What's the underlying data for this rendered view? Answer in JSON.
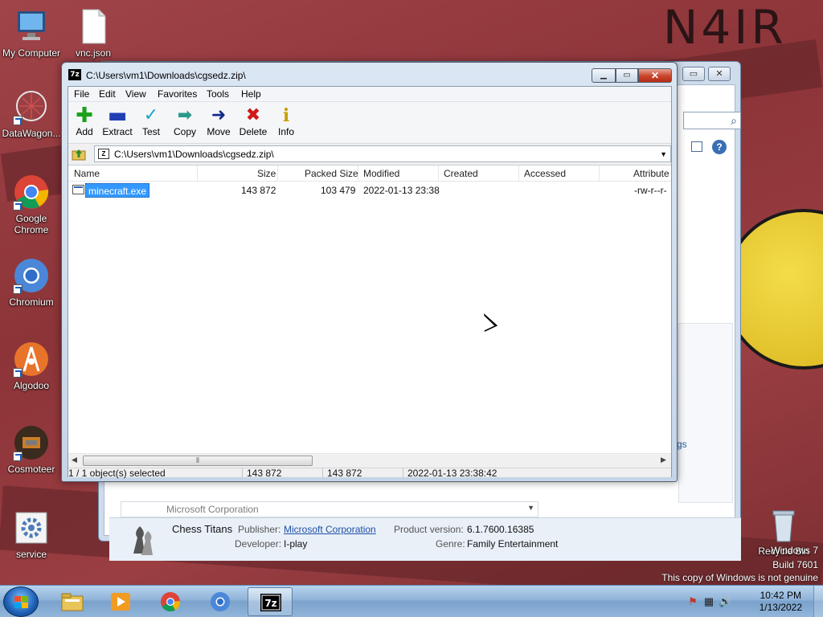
{
  "desktop": {
    "icons": [
      {
        "label": "My Computer"
      },
      {
        "label": "vnc.json"
      },
      {
        "label": "DataWagon..."
      },
      {
        "label": "Google Chrome"
      },
      {
        "label": "Chromium"
      },
      {
        "label": "Algodoo"
      },
      {
        "label": "Cosmoteer"
      },
      {
        "label": "service"
      },
      {
        "label": "Recycle Bin"
      }
    ],
    "wallpaper_text": "N4IR"
  },
  "background_window": {
    "partial_row_text": "Microsoft Corporation",
    "side_link_fragment": "gs",
    "details": {
      "name": "Chess Titans",
      "publisher_label": "Publisher:",
      "publisher_value": "Microsoft Corporation",
      "developer_label": "Developer:",
      "developer_value": "I-play",
      "version_label": "Product version:",
      "version_value": "6.1.7600.16385",
      "genre_label": "Genre:",
      "genre_value": "Family Entertainment"
    }
  },
  "sevenzip": {
    "title": "C:\\Users\\vm1\\Downloads\\cgsedz.zip\\",
    "title_icon": "7z",
    "menu": [
      "File",
      "Edit",
      "View",
      "Favorites",
      "Tools",
      "Help"
    ],
    "toolbar": [
      {
        "label": "Add",
        "icon": "plus-icon",
        "color": "#1aa31a"
      },
      {
        "label": "Extract",
        "icon": "minus-icon",
        "color": "#1f3fb3"
      },
      {
        "label": "Test",
        "icon": "check-icon",
        "color": "#1aa5c4"
      },
      {
        "label": "Copy",
        "icon": "double-arrow-icon",
        "color": "#2a9a8a"
      },
      {
        "label": "Move",
        "icon": "arrow-right-icon",
        "color": "#112a8c"
      },
      {
        "label": "Delete",
        "icon": "x-icon",
        "color": "#d01818"
      },
      {
        "label": "Info",
        "icon": "info-icon",
        "color": "#c8a000"
      }
    ],
    "address": "C:\\Users\\vm1\\Downloads\\cgsedz.zip\\",
    "columns": [
      "Name",
      "Size",
      "Packed Size",
      "Modified",
      "Created",
      "Accessed",
      "Attribute"
    ],
    "rows": [
      {
        "name": "minecraft.exe",
        "size": "143 872",
        "packed": "103 479",
        "modified": "2022-01-13 23:38",
        "created": "",
        "accessed": "",
        "attr": "-rw-r--r-"
      }
    ],
    "status": {
      "selection": "1 / 1 object(s) selected",
      "size": "143 872",
      "packed": "143 872",
      "modified": "2022-01-13 23:38:42"
    }
  },
  "taskbar": {
    "time": "10:42 PM",
    "date": "1/13/2022"
  },
  "watermark": {
    "line1": "Windows 7",
    "line2": "Build 7601",
    "line3": "This copy of Windows is not genuine"
  },
  "colors": {
    "selection": "#3399ff",
    "link": "#1f4fa8"
  }
}
